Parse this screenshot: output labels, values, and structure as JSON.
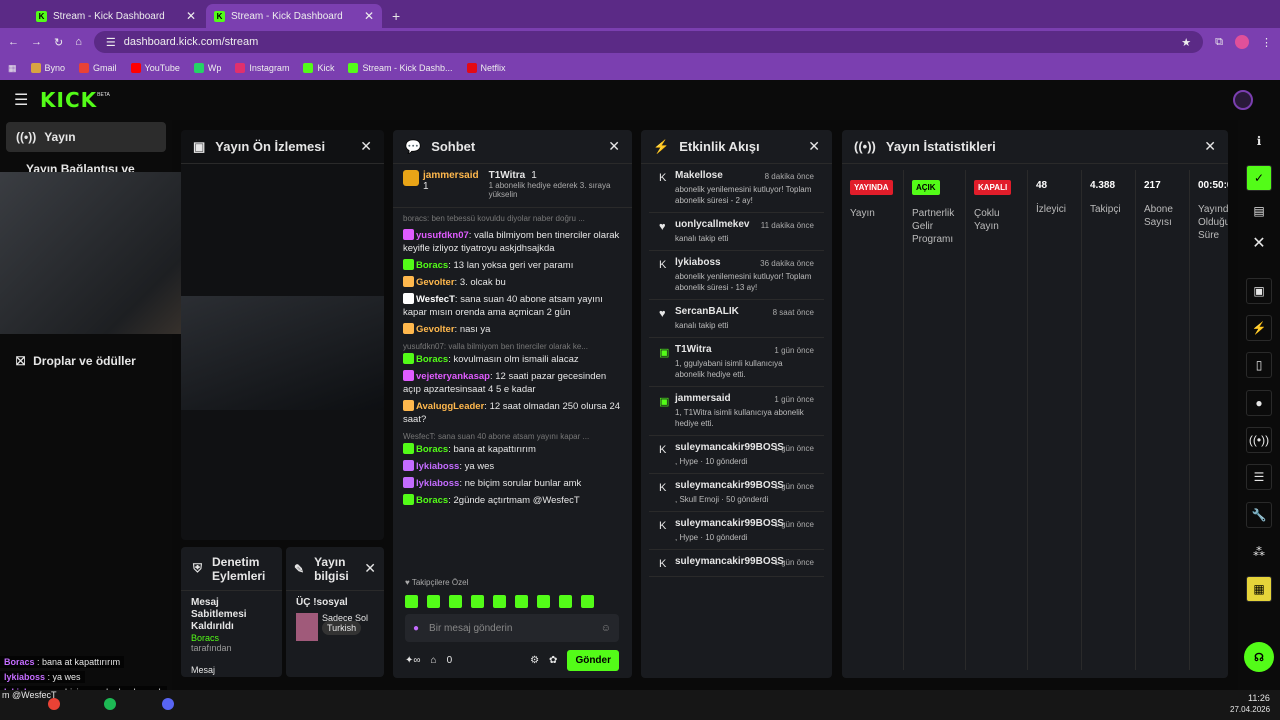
{
  "browser": {
    "tabs": [
      {
        "title": "Stream - Kick Dashboard"
      },
      {
        "title": "Stream - Kick Dashboard"
      }
    ],
    "url": "dashboard.kick.com/stream",
    "bookmarks": [
      "Byno",
      "Gmail",
      "YouTube",
      "Wp",
      "Instagram",
      "Kick",
      "Stream - Kick Dashb...",
      "Netflix"
    ]
  },
  "brand": {
    "logo": "KICK",
    "beta": "BETA",
    "accent": "#53fc18"
  },
  "leftnav": {
    "items": [
      "Yayın",
      "Yayın Bağlantısı ve Anahtarı",
      "Droplar ve ödüller"
    ]
  },
  "preview": {
    "title": "Yayın Ön İzlemesi"
  },
  "moderation": {
    "title": "Denetim Eylemleri",
    "action": "Mesaj Sabitlemesi Kaldırıldı",
    "by_user": "Boracs",
    "by_label": "tarafından",
    "next": "Mesaj"
  },
  "streaminfo": {
    "title": "Yayın bilgisi",
    "stream_title": "ÜÇ !sosyal",
    "category": "Sadece Sol",
    "language": "Turkish"
  },
  "chat": {
    "title": "Sohbet",
    "top": [
      {
        "name": "jammersaid",
        "count": "1"
      },
      {
        "name": "T1Witra",
        "count": "1",
        "note": "1 abonelik hediye ederek 3. sıraya yükselin"
      }
    ],
    "messages": [
      {
        "reply": "boracs: ben tebessü kovuldu diyolar naber doğru ...",
        "user": "",
        "text": ""
      },
      {
        "user": "yusufdkn07",
        "color": "#e05cff",
        "text": "valla bilmiyom ben tinerciler olarak keyifle izliyoz tiyatroyu askjdhsajkda"
      },
      {
        "user": "Boracs",
        "color": "#53fc18",
        "text": "13 lan yoksa geri ver paramı"
      },
      {
        "user": "Gevolter",
        "color": "#ffb84d",
        "text": "3. olcak bu"
      },
      {
        "user": "WesfecT",
        "color": "#ffffff",
        "text": "sana suan 40 abone atsam yayını kapar mısın orenda ama açmican 2 gün"
      },
      {
        "user": "Gevolter",
        "color": "#ffb84d",
        "text": "nası ya"
      },
      {
        "reply": "yusufdkn07: valla bilmiyom ben tinerciler olarak ke...",
        "user": "Boracs",
        "color": "#53fc18",
        "text": "kovulmasın olm ismaili alacaz"
      },
      {
        "user": "vejeteryankasap",
        "color": "#e05cff",
        "text": "12 saati pazar gecesinden açıp apzartesinsaat 4 5 e kadar"
      },
      {
        "user": "AvaluggLeader",
        "color": "#ffb84d",
        "text": "12 saat olmadan 250 olursa 24 saat?"
      },
      {
        "reply": "WesfecT: sana suan 40 abone atsam yayını kapar ...",
        "user": "Boracs",
        "color": "#53fc18",
        "text": "bana at kapattırırım"
      },
      {
        "user": "lykiaboss",
        "color": "#c46cff",
        "text": "ya wes"
      },
      {
        "user": "lykiaboss",
        "color": "#c46cff",
        "text": "ne biçim sorular bunlar amk"
      },
      {
        "user": "Boracs",
        "color": "#53fc18",
        "text": "2günde açtırtmam @WesfecT"
      }
    ],
    "followers_label": "Takipçilere Özel",
    "placeholder": "Bir mesaj gönderin",
    "points": "0",
    "send": "Gönder"
  },
  "activity": {
    "title": "Etkinlik Akışı",
    "items": [
      {
        "icon": "kick-icon",
        "name": "Makellose",
        "time": "8 dakika önce",
        "desc": "abonelik yenilemesini kutluyor! Toplam abonelik süresi - 2 ay!"
      },
      {
        "icon": "heart-icon",
        "name": "uonlycallmekev",
        "time": "11 dakika önce",
        "desc": "kanalı takip etti"
      },
      {
        "icon": "kick-icon",
        "name": "lykiaboss",
        "time": "36 dakika önce",
        "desc": "abonelik yenilemesini kutluyor! Toplam abonelik süresi - 13 ay!"
      },
      {
        "icon": "heart-icon",
        "name": "SercanBALIK",
        "time": "8 saat önce",
        "desc": "kanalı takip etti"
      },
      {
        "icon": "gift-icon",
        "name": "T1Witra",
        "time": "1 gün önce",
        "desc": "1, ggulyabani isimli kullanıcıya abonelik hediye etti."
      },
      {
        "icon": "gift-icon",
        "name": "jammersaid",
        "time": "1 gün önce",
        "desc": "1, T1Witra isimli kullanıcıya abonelik hediye etti."
      },
      {
        "icon": "kick-icon",
        "name": "suleymancakir99BOSS",
        "time": "1 gün önce",
        "desc": ", Hype · 10 gönderdi"
      },
      {
        "icon": "kick-icon",
        "name": "suleymancakir99BOSS",
        "time": "1 gün önce",
        "desc": ", Skull Emoji · 50 gönderdi"
      },
      {
        "icon": "kick-icon",
        "name": "suleymancakir99BOSS",
        "time": "1 gün önce",
        "desc": ", Hype · 10 gönderdi"
      },
      {
        "icon": "kick-icon",
        "name": "suleymancakir99BOSS",
        "time": "1 gün önce",
        "desc": ""
      }
    ]
  },
  "stats": {
    "title": "Yayın İstatistikleri",
    "cols": [
      {
        "value": "YAYINDA",
        "label": "Yayın",
        "kind": "red"
      },
      {
        "value": "AÇIK",
        "label": "Partnerlik Gelir Programı",
        "kind": "green"
      },
      {
        "value": "KAPALI",
        "label": "Çoklu Yayın",
        "kind": "red"
      },
      {
        "value": "48",
        "label": "İzleyici"
      },
      {
        "value": "4.388",
        "label": "Takipçi"
      },
      {
        "value": "217",
        "label": "Abone Sayısı"
      },
      {
        "value": "00:50:0",
        "label": "Yayında Olduğu Süre"
      }
    ]
  },
  "overlay": {
    "lines": [
      {
        "user": "Boracs",
        "text": "bana at kapattırırım"
      },
      {
        "user": "lykiaboss",
        "text": "ya wes"
      },
      {
        "user": "lykiaboss",
        "text": "ne biçim sorular bunlar amk"
      }
    ],
    "tail": "m @WesfecT"
  },
  "taskbar": {
    "time": "11:26",
    "date": "27.04.2026"
  }
}
